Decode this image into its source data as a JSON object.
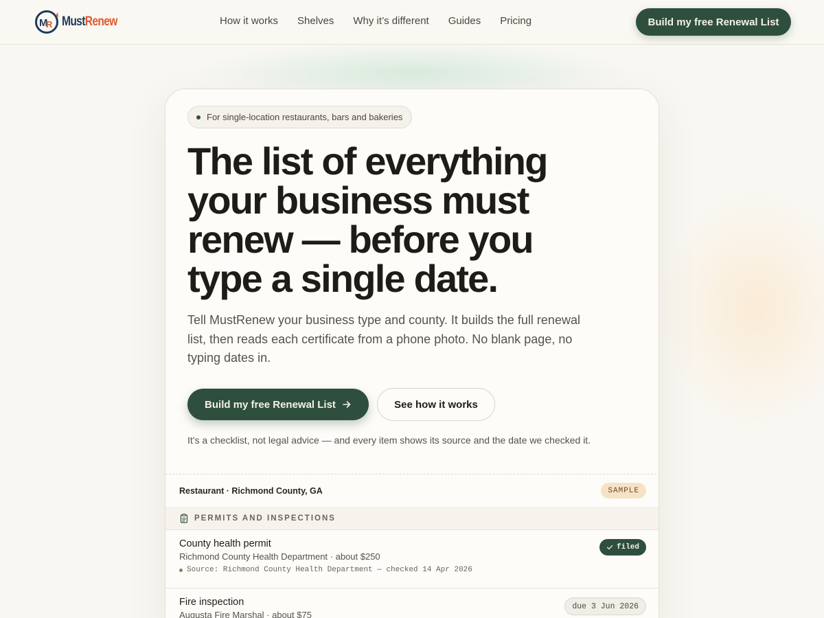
{
  "brand": {
    "name_part1": "Must",
    "name_part2": "Renew",
    "logo_icon": "mr-monogram-icon"
  },
  "nav": {
    "items": [
      {
        "label": "How it works"
      },
      {
        "label": "Shelves"
      },
      {
        "label": "Why it’s different"
      },
      {
        "label": "Guides"
      },
      {
        "label": "Pricing"
      }
    ],
    "cta_label": "Build my free Renewal List"
  },
  "hero": {
    "eyebrow": "For single-location restaurants, bars and bakeries",
    "headline": "The list of everything your business must renew — before you type a single date.",
    "lede": "Tell MustRenew your business type and county. It builds the full renewal list, then reads each certificate from a phone photo. No blank page, no typing dates in.",
    "primary_cta": "Build my free Renewal List",
    "primary_cta_icon": "arrow-right-icon",
    "secondary_cta": "See how it works",
    "disclaimer": "It's a checklist, not legal advice — and every item shows its source and the date we checked it."
  },
  "sample_list": {
    "context": "Restaurant · Richmond County, GA",
    "badge": "SAMPLE",
    "section": {
      "title": "PERMITS AND INSPECTIONS",
      "icon": "clipboard-icon"
    },
    "items": [
      {
        "title": "County health permit",
        "subtitle": "Richmond County Health Department · about $250",
        "source": "Source: Richmond County Health Department — checked 14 Apr 2026",
        "status": "filed",
        "status_icon": "check-icon"
      },
      {
        "title": "Fire inspection",
        "subtitle": "Augusta Fire Marshal · about $75",
        "status": "due 3 Jun 2026"
      }
    ]
  },
  "colors": {
    "background": "#f9f7f2",
    "brand_green": "#2f4f3e",
    "brand_navy": "#1f3a5c",
    "brand_orange": "#e05a2a",
    "sample_badge": "#f6e2c6"
  }
}
